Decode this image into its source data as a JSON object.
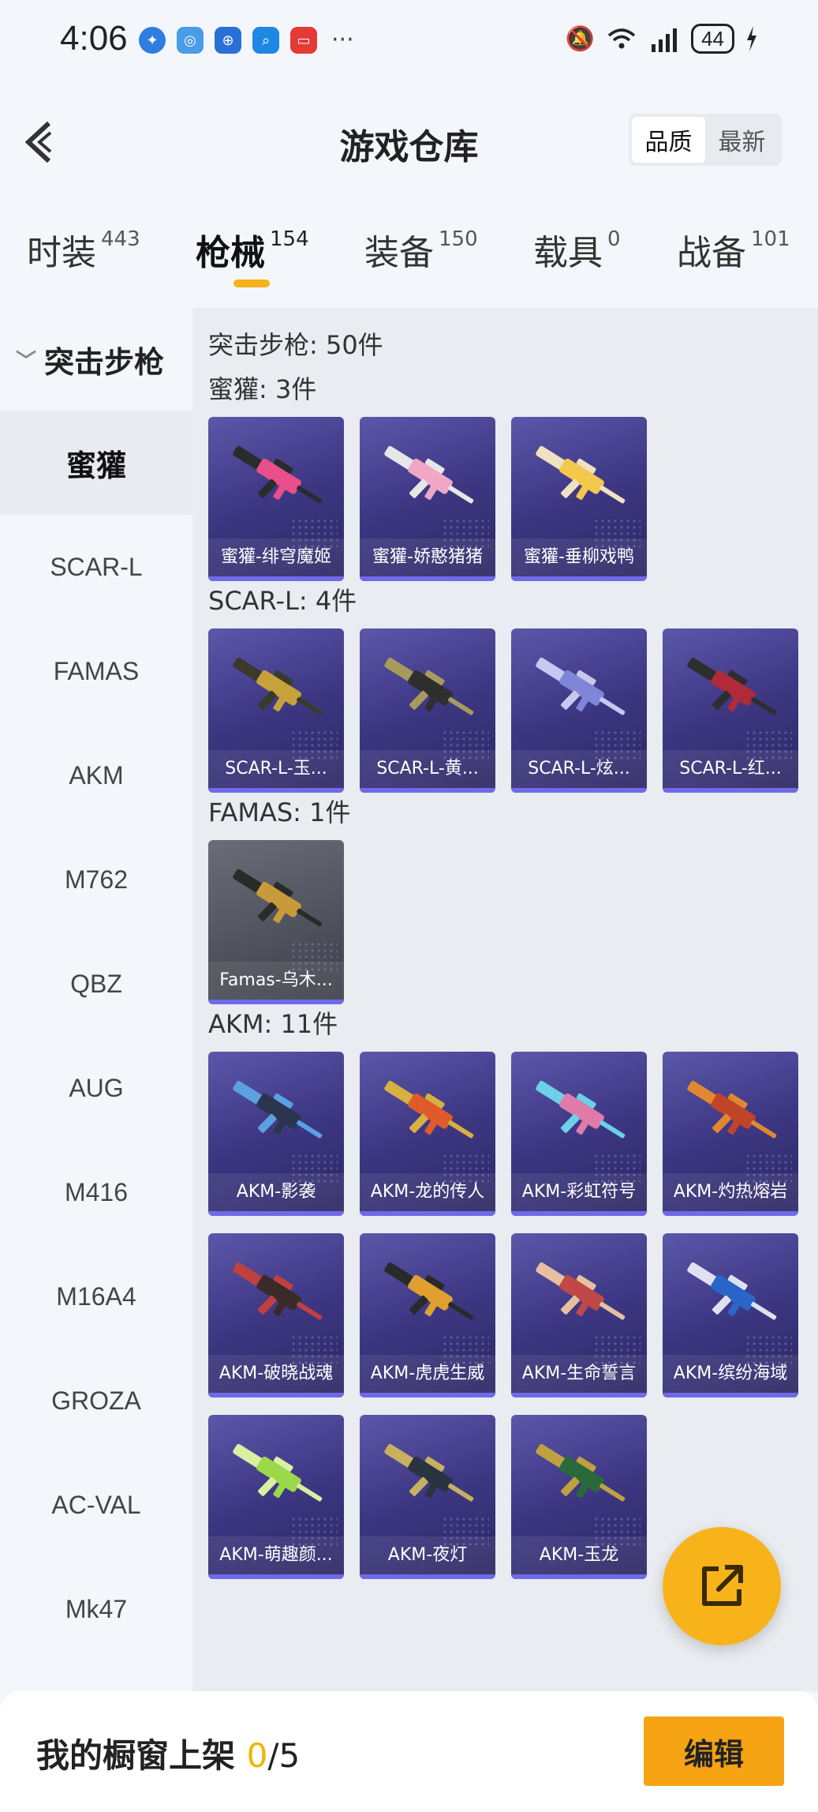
{
  "status_bar": {
    "time": "4:06",
    "battery": "44",
    "more": "···"
  },
  "header": {
    "title": "游戏仓库",
    "sort_options": [
      "品质",
      "最新"
    ],
    "active_sort": "品质"
  },
  "tabs": [
    {
      "label": "时装",
      "count": "443"
    },
    {
      "label": "枪械",
      "count": "154",
      "active": true
    },
    {
      "label": "装备",
      "count": "150"
    },
    {
      "label": "载具",
      "count": "0"
    },
    {
      "label": "战备",
      "count": "101"
    }
  ],
  "sidebar": {
    "category": "突击步枪",
    "items": [
      "蜜獾",
      "SCAR-L",
      "FAMAS",
      "AKM",
      "M762",
      "QBZ",
      "AUG",
      "M416",
      "M16A4",
      "GROZA",
      "AC-VAL",
      "Mk47"
    ],
    "active_item": "蜜獾"
  },
  "content": {
    "total": "突击步枪: 50件",
    "sections": [
      {
        "title": "蜜獾: 3件",
        "items": [
          "蜜獾-绯穹魔姬",
          "蜜獾-娇憨猪猪",
          "蜜獾-垂柳戏鸭"
        ]
      },
      {
        "title": "SCAR-L: 4件",
        "items": [
          "SCAR-L-玉...",
          "SCAR-L-黄...",
          "SCAR-L-炫...",
          "SCAR-L-红..."
        ]
      },
      {
        "title": "FAMAS: 1件",
        "items": [
          "Famas-乌木..."
        ]
      },
      {
        "title": "AKM: 11件",
        "items": [
          "AKM-影袭",
          "AKM-龙的传人",
          "AKM-彩虹符号",
          "AKM-灼热熔岩",
          "AKM-破晓战魂",
          "AKM-虎虎生威",
          "AKM-生命誓言",
          "AKM-缤纷海域",
          "AKM-萌趣颜...",
          "AKM-夜灯",
          "AKM-玉龙"
        ]
      }
    ]
  },
  "bottom_bar": {
    "label": "我的橱窗上架",
    "count": "0",
    "total": "/5",
    "edit_label": "编辑"
  },
  "colors": {
    "accent": "#f6a414",
    "tab_underline": "#f6b21a",
    "card_purple": "#3f3986",
    "card_grey": "#50535d",
    "card_bar": "#6e6ae8"
  }
}
